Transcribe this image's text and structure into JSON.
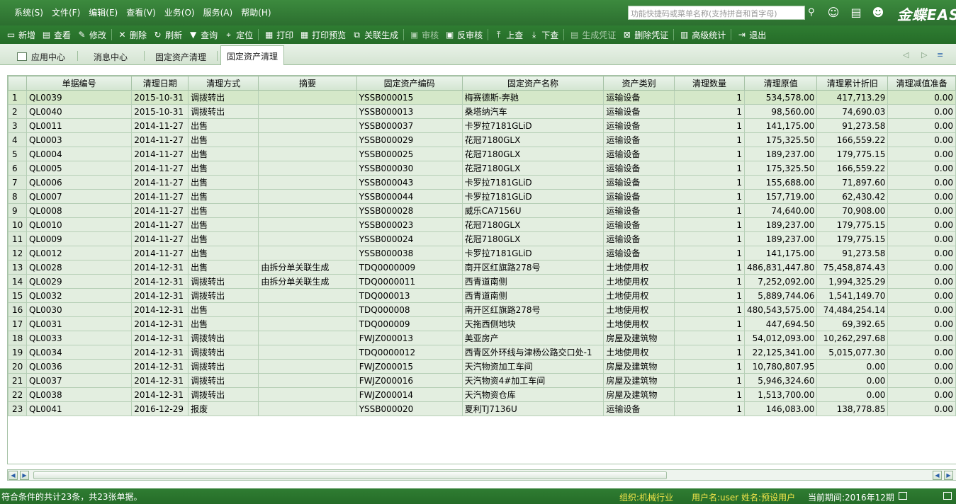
{
  "menubar": {
    "menus": [
      "系统(S)",
      "文件(F)",
      "编辑(E)",
      "查看(V)",
      "业务(O)",
      "服务(A)",
      "帮助(H)"
    ],
    "search_placeholder": "功能快捷码或菜单名称(支持拼音和首字母)",
    "brand": "金蝶EAS"
  },
  "toolbar": [
    {
      "label": "新增",
      "icon": "new-doc-icon",
      "glyph": "▭",
      "enabled": true
    },
    {
      "label": "查看",
      "icon": "view-icon",
      "glyph": "▤",
      "enabled": true
    },
    {
      "label": "修改",
      "icon": "edit-icon",
      "glyph": "✎",
      "enabled": true
    },
    {
      "sep": true
    },
    {
      "label": "删除",
      "icon": "delete-icon",
      "glyph": "✕",
      "enabled": true
    },
    {
      "label": "刷新",
      "icon": "refresh-icon",
      "glyph": "↻",
      "enabled": true
    },
    {
      "label": "查询",
      "icon": "filter-icon",
      "glyph": "▼",
      "enabled": true
    },
    {
      "label": "定位",
      "icon": "locate-icon",
      "glyph": "⌖",
      "enabled": true
    },
    {
      "sep": true
    },
    {
      "label": "打印",
      "icon": "print-icon",
      "glyph": "▦",
      "enabled": true
    },
    {
      "label": "打印预览",
      "icon": "print-preview-icon",
      "glyph": "▦",
      "enabled": true
    },
    {
      "label": "关联生成",
      "icon": "link-generate-icon",
      "glyph": "⧉",
      "enabled": true
    },
    {
      "sep": true
    },
    {
      "label": "审核",
      "icon": "audit-icon",
      "glyph": "▣",
      "enabled": false
    },
    {
      "label": "反审核",
      "icon": "unaudit-icon",
      "glyph": "▣",
      "enabled": true
    },
    {
      "sep": true
    },
    {
      "label": "上查",
      "icon": "trace-up-icon",
      "glyph": "⤒",
      "enabled": true
    },
    {
      "label": "下查",
      "icon": "trace-down-icon",
      "glyph": "⤓",
      "enabled": true
    },
    {
      "sep": true
    },
    {
      "label": "生成凭证",
      "icon": "voucher-icon",
      "glyph": "▤",
      "enabled": false
    },
    {
      "label": "删除凭证",
      "icon": "delete-voucher-icon",
      "glyph": "⊠",
      "enabled": true
    },
    {
      "sep": true
    },
    {
      "label": "高级统计",
      "icon": "statistics-icon",
      "glyph": "▥",
      "enabled": true
    },
    {
      "sep": true
    },
    {
      "label": "退出",
      "icon": "exit-icon",
      "glyph": "⇥",
      "enabled": true
    }
  ],
  "tabs": [
    {
      "label": "应用中心",
      "active": false
    },
    {
      "label": "消息中心",
      "active": false
    },
    {
      "label": "固定资产清理",
      "active": false
    },
    {
      "label": "固定资产清理",
      "active": true
    }
  ],
  "table": {
    "columns": [
      "",
      "单据编号",
      "清理日期",
      "清理方式",
      "摘要",
      "固定资产编码",
      "固定资产名称",
      "资产类别",
      "清理数量",
      "清理原值",
      "清理累计折旧",
      "清理减值准备"
    ],
    "rows": [
      [
        "1",
        "QL0039",
        "2015-10-31",
        "调拨转出",
        "",
        "YSSB000015",
        "梅赛德斯-奔驰",
        "运输设备",
        "1",
        "534,578.00",
        "417,713.29",
        "0.00"
      ],
      [
        "2",
        "QL0040",
        "2015-10-31",
        "调拨转出",
        "",
        "YSSB000013",
        "桑塔纳汽车",
        "运输设备",
        "1",
        "98,560.00",
        "74,690.03",
        "0.00"
      ],
      [
        "3",
        "QL0011",
        "2014-11-27",
        "出售",
        "",
        "YSSB000037",
        "卡罗拉7181GLiD",
        "运输设备",
        "1",
        "141,175.00",
        "91,273.58",
        "0.00"
      ],
      [
        "4",
        "QL0003",
        "2014-11-27",
        "出售",
        "",
        "YSSB000029",
        "花冠7180GLX",
        "运输设备",
        "1",
        "175,325.50",
        "166,559.22",
        "0.00"
      ],
      [
        "5",
        "QL0004",
        "2014-11-27",
        "出售",
        "",
        "YSSB000025",
        "花冠7180GLX",
        "运输设备",
        "1",
        "189,237.00",
        "179,775.15",
        "0.00"
      ],
      [
        "6",
        "QL0005",
        "2014-11-27",
        "出售",
        "",
        "YSSB000030",
        "花冠7180GLX",
        "运输设备",
        "1",
        "175,325.50",
        "166,559.22",
        "0.00"
      ],
      [
        "7",
        "QL0006",
        "2014-11-27",
        "出售",
        "",
        "YSSB000043",
        "卡罗拉7181GLiD",
        "运输设备",
        "1",
        "155,688.00",
        "71,897.60",
        "0.00"
      ],
      [
        "8",
        "QL0007",
        "2014-11-27",
        "出售",
        "",
        "YSSB000044",
        "卡罗拉7181GLiD",
        "运输设备",
        "1",
        "157,719.00",
        "62,430.42",
        "0.00"
      ],
      [
        "9",
        "QL0008",
        "2014-11-27",
        "出售",
        "",
        "YSSB000028",
        "威乐CA7156U",
        "运输设备",
        "1",
        "74,640.00",
        "70,908.00",
        "0.00"
      ],
      [
        "10",
        "QL0010",
        "2014-11-27",
        "出售",
        "",
        "YSSB000023",
        "花冠7180GLX",
        "运输设备",
        "1",
        "189,237.00",
        "179,775.15",
        "0.00"
      ],
      [
        "11",
        "QL0009",
        "2014-11-27",
        "出售",
        "",
        "YSSB000024",
        "花冠7180GLX",
        "运输设备",
        "1",
        "189,237.00",
        "179,775.15",
        "0.00"
      ],
      [
        "12",
        "QL0012",
        "2014-11-27",
        "出售",
        "",
        "YSSB000038",
        "卡罗拉7181GLiD",
        "运输设备",
        "1",
        "141,175.00",
        "91,273.58",
        "0.00"
      ],
      [
        "13",
        "QL0028",
        "2014-12-31",
        "出售",
        "由拆分单关联生成",
        "TDQ0000009",
        "南开区红旗路278号",
        "土地使用权",
        "1",
        "486,831,447.80",
        "75,458,874.43",
        "0.00"
      ],
      [
        "14",
        "QL0029",
        "2014-12-31",
        "调拨转出",
        "由拆分单关联生成",
        "TDQ0000011",
        "西青道南侧",
        "土地使用权",
        "1",
        "7,252,092.00",
        "1,994,325.29",
        "0.00"
      ],
      [
        "15",
        "QL0032",
        "2014-12-31",
        "调拨转出",
        "",
        "TDQ000013",
        "西青道南侧",
        "土地使用权",
        "1",
        "5,889,744.06",
        "1,541,149.70",
        "0.00"
      ],
      [
        "16",
        "QL0030",
        "2014-12-31",
        "出售",
        "",
        "TDQ000008",
        "南开区红旗路278号",
        "土地使用权",
        "1",
        "480,543,575.00",
        "74,484,254.14",
        "0.00"
      ],
      [
        "17",
        "QL0031",
        "2014-12-31",
        "出售",
        "",
        "TDQ000009",
        "天拖西侧地块",
        "土地使用权",
        "1",
        "447,694.50",
        "69,392.65",
        "0.00"
      ],
      [
        "18",
        "QL0033",
        "2014-12-31",
        "调拨转出",
        "",
        "FWJZ000013",
        "美亚房产",
        "房屋及建筑物",
        "1",
        "54,012,093.00",
        "10,262,297.68",
        "0.00"
      ],
      [
        "19",
        "QL0034",
        "2014-12-31",
        "调拨转出",
        "",
        "TDQ0000012",
        "西青区外环线与津杨公路交口处-1",
        "土地使用权",
        "1",
        "22,125,341.00",
        "5,015,077.30",
        "0.00"
      ],
      [
        "20",
        "QL0036",
        "2014-12-31",
        "调拨转出",
        "",
        "FWJZ000015",
        "天汽物资加工车间",
        "房屋及建筑物",
        "1",
        "10,780,807.95",
        "0.00",
        "0.00"
      ],
      [
        "21",
        "QL0037",
        "2014-12-31",
        "调拨转出",
        "",
        "FWJZ000016",
        "天汽物资4#加工车间",
        "房屋及建筑物",
        "1",
        "5,946,324.60",
        "0.00",
        "0.00"
      ],
      [
        "22",
        "QL0038",
        "2014-12-31",
        "调拨转出",
        "",
        "FWJZ000014",
        "天汽物资仓库",
        "房屋及建筑物",
        "1",
        "1,513,700.00",
        "0.00",
        "0.00"
      ],
      [
        "23",
        "QL0041",
        "2016-12-29",
        "报废",
        "",
        "YSSB000020",
        "夏利TJ7136U",
        "运输设备",
        "1",
        "146,083.00",
        "138,778.85",
        "0.00"
      ]
    ]
  },
  "statusbar": {
    "summary": "符合条件的共计23条，共23张单据。",
    "org": "组织:机械行业",
    "user": "用户名:user  姓名:预设用户",
    "period": "当前期间:2016年12期"
  }
}
